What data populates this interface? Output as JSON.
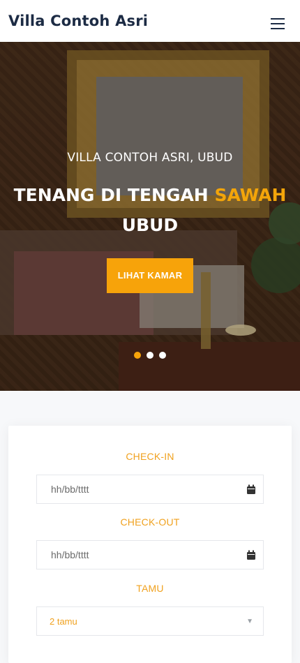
{
  "brand": {
    "name": "Villa Contoh Asri"
  },
  "nav": {
    "menu_icon": "hamburger-menu-icon"
  },
  "hero": {
    "kicker": "VILLA CONTOH ASRI, UBUD",
    "title_main": "TENANG DI TENGAH ",
    "title_accent": "SAWAH",
    "title_end": "UBUD",
    "cta": "LIHAT KAMAR",
    "slides": [
      {
        "active": true
      },
      {
        "active": false
      },
      {
        "active": false
      }
    ]
  },
  "booking": {
    "checkin_label": "CHECK-IN",
    "checkin_placeholder": "hh/bb/tttt",
    "checkout_label": "CHECK-OUT",
    "checkout_placeholder": "hh/bb/tttt",
    "guests_label": "TAMU",
    "guests_value": "2 tamu",
    "calendar_icon": "calendar-icon",
    "select_icon": "chevron-down-icon"
  },
  "colors": {
    "accent": "#f7a30a",
    "brand_text": "#1c2b44",
    "label": "#f0a11e"
  }
}
